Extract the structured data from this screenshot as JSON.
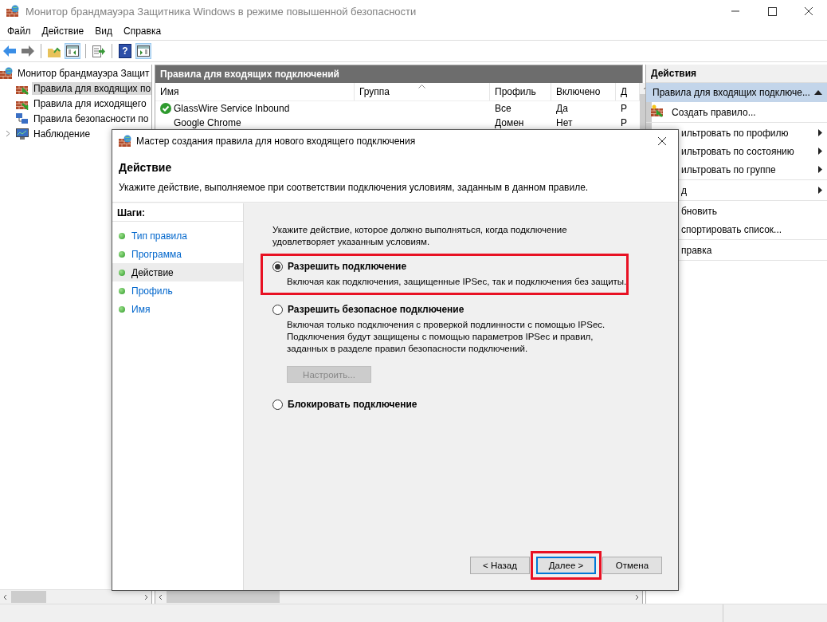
{
  "window": {
    "title": "Монитор брандмауэра Защитника Windows в режиме повышенной безопасности"
  },
  "menu": [
    "Файл",
    "Действие",
    "Вид",
    "Справка"
  ],
  "toolbar": [
    {
      "kind": "back",
      "pressed": false
    },
    {
      "kind": "forward",
      "pressed": false
    },
    {
      "kind": "folder-up",
      "pressed": false
    },
    {
      "kind": "tree-pane",
      "pressed": true
    },
    {
      "kind": "export",
      "pressed": false
    },
    {
      "kind": "help",
      "pressed": false,
      "glyph": "?"
    },
    {
      "kind": "action-pane",
      "pressed": true
    }
  ],
  "tree": {
    "root": "Монитор брандмауэра Защит",
    "children": [
      {
        "label": "Правила для входящих по",
        "kind": "inbound",
        "selected": true,
        "expandable": false
      },
      {
        "label": "Правила для исходящего",
        "kind": "outbound",
        "selected": false,
        "expandable": false
      },
      {
        "label": "Правила безопасности по",
        "kind": "security",
        "selected": false,
        "expandable": false
      },
      {
        "label": "Наблюдение",
        "kind": "monitor",
        "selected": false,
        "expandable": true
      }
    ]
  },
  "table": {
    "title": "Правила для входящих подключений",
    "columns": [
      "Имя",
      "Группа",
      "Профиль",
      "Включено",
      "Д"
    ],
    "rows": [
      {
        "enabled": true,
        "cells": [
          "GlassWire Service Inbound",
          "",
          "Все",
          "Да",
          "Р"
        ]
      },
      {
        "enabled": false,
        "cells": [
          "Google Chrome",
          "",
          "Домен",
          "Нет",
          "Р"
        ]
      }
    ]
  },
  "actions": {
    "title": "Действия",
    "section": "Правила для входящих подключе...",
    "item_groups": [
      [
        {
          "label": "Создать правило...",
          "submenu": false,
          "icon": true
        }
      ],
      [
        {
          "label": "ильтровать по профилю",
          "submenu": true,
          "icon": false
        },
        {
          "label": "ильтровать по состоянию",
          "submenu": true,
          "icon": false
        },
        {
          "label": "ильтровать по группе",
          "submenu": true,
          "icon": false
        }
      ],
      [
        {
          "label": "д",
          "submenu": true,
          "icon": false
        }
      ],
      [
        {
          "label": "бновить",
          "submenu": false,
          "icon": false
        },
        {
          "label": "спортировать список...",
          "submenu": false,
          "icon": false
        }
      ],
      [
        {
          "label": "правка",
          "submenu": false,
          "icon": false
        }
      ]
    ]
  },
  "dialog": {
    "title": "Мастер создания правила для нового входящего подключения",
    "heading": "Действие",
    "subtitle": "Укажите действие, выполняемое при соответствии подключения условиям, заданным в данном правиле.",
    "steps_title": "Шаги:",
    "steps": [
      {
        "label": "Тип правила",
        "selected": false
      },
      {
        "label": "Программа",
        "selected": false
      },
      {
        "label": "Действие",
        "selected": true
      },
      {
        "label": "Профиль",
        "selected": false
      },
      {
        "label": "Имя",
        "selected": false
      }
    ],
    "prompt": "Укажите действие, которое должно выполняться, когда подключение удовлетворяет указанным условиям.",
    "options": [
      {
        "label": "Разрешить подключение",
        "selected": true,
        "highlighted": true,
        "description": "Включая как подключения, защищенные IPSec, так и подключения без защиты."
      },
      {
        "label": "Разрешить безопасное подключение",
        "selected": false,
        "highlighted": false,
        "description": "Включая только подключения с проверкой подлинности с помощью IPSec. Подключения будут защищены с помощью параметров IPSec и правил, заданных в разделе правил безопасности подключений.",
        "button": {
          "label": "Настроить...",
          "disabled": true
        }
      },
      {
        "label": "Блокировать подключение",
        "selected": false,
        "highlighted": false
      }
    ],
    "buttons": [
      {
        "label": "< Назад",
        "default": false,
        "highlighted": false
      },
      {
        "label": "Далее >",
        "default": true,
        "highlighted": true
      },
      {
        "label": "Отмена",
        "default": false,
        "highlighted": false
      }
    ]
  }
}
